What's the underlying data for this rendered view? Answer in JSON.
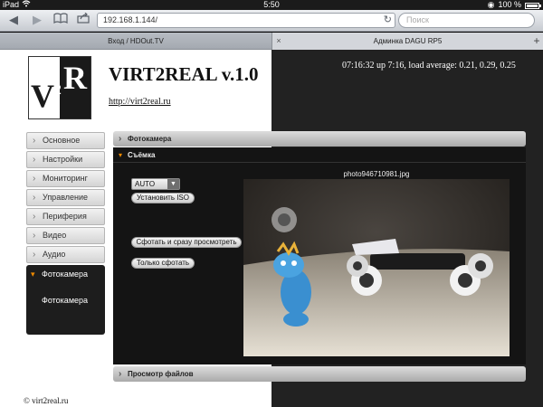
{
  "status_bar": {
    "device": "iPad",
    "time": "5:50",
    "battery": "100 %"
  },
  "browser": {
    "url": "192.168.1.144/",
    "search_placeholder": "Поиск",
    "tabs": [
      {
        "label": "Вход / HDOut.TV"
      },
      {
        "label": "Админка DAGU RP5"
      }
    ],
    "new_tab": "+",
    "close": "×"
  },
  "header": {
    "logo": {
      "text_left": "V",
      "text_sup": "2",
      "text_right": "R"
    },
    "title": "VIRT2REAL v.1.0",
    "link": "http://virt2real.ru",
    "uptime": "07:16:32 up 7:16, load average: 0.21, 0.29, 0.25"
  },
  "sidebar": {
    "items": [
      {
        "label": "Основное"
      },
      {
        "label": "Настройки"
      },
      {
        "label": "Мониторинг"
      },
      {
        "label": "Управление"
      },
      {
        "label": "Периферия"
      },
      {
        "label": "Видео"
      },
      {
        "label": "Аудио"
      }
    ],
    "active": {
      "label": "Фотокамера",
      "sub": "Фотокамера"
    }
  },
  "main": {
    "panel_title": "Фотокамера",
    "section_title": "Съёмка",
    "iso_select": "AUTO",
    "set_iso_button": "Установить ISO",
    "shoot_view_button": "Сфотать и сразу просмотреть",
    "shoot_button": "Только сфотать",
    "photo_name": "photo946710981.jpg",
    "files_panel": "Просмотр файлов"
  },
  "footer": {
    "copyright": "© virt2real.ru"
  }
}
